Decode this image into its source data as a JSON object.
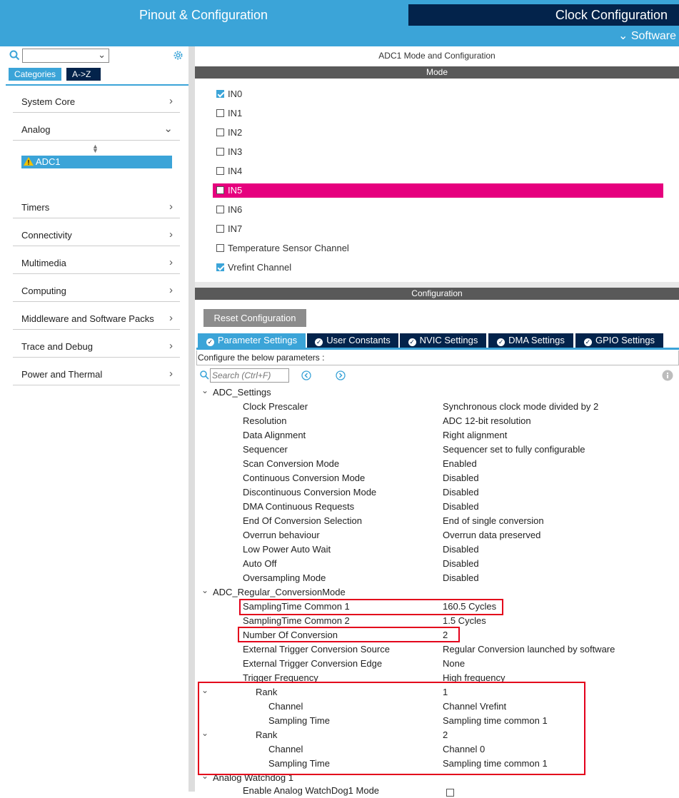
{
  "header": {
    "tab_pinout": "Pinout & Configuration",
    "tab_clock": "Clock Configuration",
    "software_label": "Software"
  },
  "sidebar": {
    "tab_categories": "Categories",
    "tab_az": "A->Z",
    "categories": [
      {
        "label": "System Core",
        "expanded": false
      },
      {
        "label": "Analog",
        "expanded": true
      },
      {
        "label": "Timers",
        "expanded": false
      },
      {
        "label": "Connectivity",
        "expanded": false
      },
      {
        "label": "Multimedia",
        "expanded": false
      },
      {
        "label": "Computing",
        "expanded": false
      },
      {
        "label": "Middleware and Software Packs",
        "expanded": false
      },
      {
        "label": "Trace and Debug",
        "expanded": false
      },
      {
        "label": "Power and Thermal",
        "expanded": false
      }
    ],
    "selected_item": "ADC1",
    "warn_color": "#f2c200"
  },
  "panel_title": "ADC1 Mode and Configuration",
  "mode": {
    "header": "Mode",
    "items": [
      {
        "label": "IN0",
        "checked": true
      },
      {
        "label": "IN1",
        "checked": false
      },
      {
        "label": "IN2",
        "checked": false
      },
      {
        "label": "IN3",
        "checked": false
      },
      {
        "label": "IN4",
        "checked": false
      },
      {
        "label": "IN5",
        "checked": false,
        "highlight": true
      },
      {
        "label": "IN6",
        "checked": false
      },
      {
        "label": "IN7",
        "checked": false
      },
      {
        "label": "Temperature Sensor Channel",
        "checked": false
      },
      {
        "label": "Vrefint Channel",
        "checked": true
      }
    ],
    "highlight_color": "#e6007e"
  },
  "config": {
    "header": "Configuration",
    "reset_label": "Reset Configuration",
    "tabs": [
      "Parameter Settings",
      "User Constants",
      "NVIC Settings",
      "DMA Settings",
      "GPIO Settings"
    ],
    "hint": "Configure the below parameters :",
    "search_placeholder": "Search (Ctrl+F)",
    "groups": [
      {
        "title": "ADC_Settings",
        "params": [
          [
            "Clock Prescaler",
            "Synchronous clock mode divided by 2"
          ],
          [
            "Resolution",
            "ADC 12-bit resolution"
          ],
          [
            "Data Alignment",
            "Right alignment"
          ],
          [
            "Sequencer",
            "Sequencer set to fully configurable"
          ],
          [
            "Scan Conversion Mode",
            "Enabled"
          ],
          [
            "Continuous Conversion Mode",
            "Disabled"
          ],
          [
            "Discontinuous Conversion Mode",
            "Disabled"
          ],
          [
            "DMA Continuous Requests",
            "Disabled"
          ],
          [
            "End Of Conversion Selection",
            "End of single conversion"
          ],
          [
            "Overrun behaviour",
            "Overrun data preserved"
          ],
          [
            "Low Power Auto Wait",
            "Disabled"
          ],
          [
            "Auto Off",
            "Disabled"
          ],
          [
            "Oversampling Mode",
            "Disabled"
          ]
        ]
      },
      {
        "title": "ADC_Regular_ConversionMode",
        "params": [
          [
            "SamplingTime Common 1",
            "160.5 Cycles"
          ],
          [
            "SamplingTime Common 2",
            "1.5 Cycles"
          ],
          [
            "Number Of Conversion",
            "2"
          ],
          [
            "External Trigger Conversion Source",
            "Regular Conversion launched by software"
          ],
          [
            "External Trigger Conversion Edge",
            "None"
          ],
          [
            "Trigger Frequency",
            "High frequency"
          ]
        ]
      }
    ],
    "ranks": [
      {
        "label": "Rank",
        "value": "1",
        "channel_label": "Channel",
        "channel": "Channel Vrefint",
        "st_label": "Sampling Time",
        "st": "Sampling time common 1"
      },
      {
        "label": "Rank",
        "value": "2",
        "channel_label": "Channel",
        "channel": "Channel 0",
        "st_label": "Sampling Time",
        "st": "Sampling time common 1"
      }
    ],
    "watchdog_title": "Analog Watchdog 1",
    "watchdog_param": "Enable Analog WatchDog1 Mode"
  }
}
